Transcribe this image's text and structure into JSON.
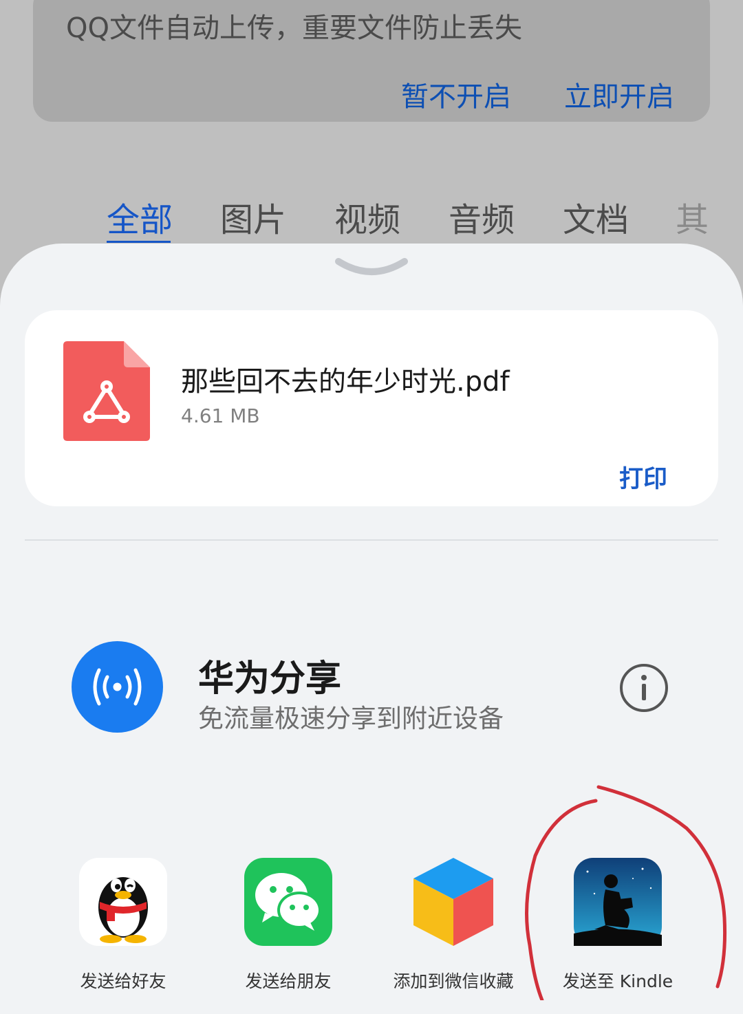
{
  "background": {
    "banner_message": "QQ文件自动上传，重要文件防止丢失",
    "later_label": "暂不开启",
    "enable_label": "立即开启",
    "tabs": [
      "全部",
      "图片",
      "视频",
      "音频",
      "文档",
      "其"
    ],
    "active_tab": "全部"
  },
  "file": {
    "name": "那些回不去的年少时光.pdf",
    "size": "4.61 MB",
    "icon": "pdf-file-icon",
    "print_label": "打印"
  },
  "huawei_share": {
    "title": "华为分享",
    "subtitle": "免流量极速分享到附近设备",
    "icon": "huawei-share-icon"
  },
  "apps": [
    {
      "label": "发送给好友",
      "icon": "qq-penguin-icon"
    },
    {
      "label": "发送给朋友",
      "icon": "wechat-icon"
    },
    {
      "label": "添加到微信收藏",
      "icon": "wechat-favorites-cube-icon"
    },
    {
      "label": "发送至 Kindle",
      "icon": "kindle-reader-icon"
    }
  ],
  "colors": {
    "accent_blue": "#1555c7",
    "pdf_red": "#f25c5c",
    "huawei_blue": "#1a7cf0",
    "wechat_green": "#1fc35b",
    "annotation_red": "#d1303a"
  }
}
